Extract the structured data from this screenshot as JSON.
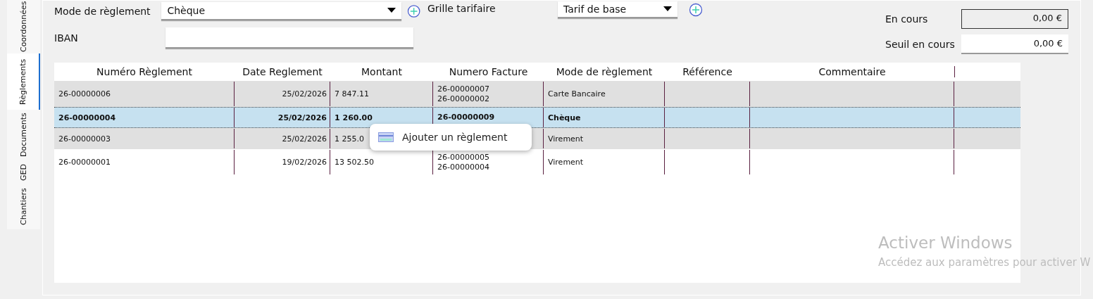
{
  "side_tabs": [
    {
      "label": "Coordonnées",
      "selected": false
    },
    {
      "label": "Règlements",
      "selected": true
    },
    {
      "label": "Documents",
      "selected": false
    },
    {
      "label": "GED",
      "selected": false
    },
    {
      "label": "Chantiers",
      "selected": false
    }
  ],
  "form": {
    "payment_mode": {
      "label": "Mode de règlement",
      "value": "Chèque"
    },
    "iban": {
      "label": "IBAN"
    },
    "price_grid": {
      "label": "Grille tarifaire",
      "value": "Tarif de base"
    },
    "current": {
      "label": "En cours",
      "value": "0,00 €"
    },
    "threshold": {
      "label": "Seuil en cours",
      "value": "0,00 €"
    }
  },
  "table": {
    "columns": [
      "Numéro Règlement",
      "Date Reglement",
      "Montant",
      "Numero Facture",
      "Mode de règlement",
      "Référence",
      "Commentaire"
    ],
    "rows": [
      {
        "selected": false,
        "number": "26-00000006",
        "date": "25/02/2026",
        "amount": "7 847.11",
        "invoices": [
          "26-00000007",
          "26-00000002"
        ],
        "mode": "Carte Bancaire"
      },
      {
        "selected": true,
        "number": "26-00000004",
        "date": "25/02/2026",
        "amount": "1 260.00",
        "invoices": [
          "26-00000009"
        ],
        "mode": "Chèque"
      },
      {
        "selected": false,
        "number": "26-00000003",
        "date": "25/02/2026",
        "amount": "1 255.0",
        "invoices": [],
        "mode": "Virement"
      },
      {
        "selected": false,
        "number": "26-00000001",
        "date": "19/02/2026",
        "amount": "13 502.50",
        "invoices": [
          "26-00000005",
          "26-00000004"
        ],
        "mode": "Virement"
      }
    ]
  },
  "context_menu": {
    "items": [
      "Ajouter un règlement"
    ]
  },
  "windows_notice": {
    "title": "Activer Windows",
    "text": "Accédez aux paramètres pour activer W"
  }
}
